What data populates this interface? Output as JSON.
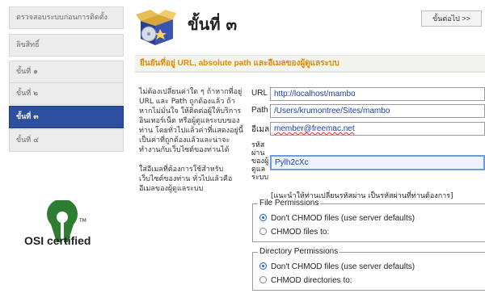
{
  "sidebar": {
    "items": [
      {
        "label": "ตรวจสอบระบบก่อนการติดตั้ง",
        "active": false
      },
      {
        "label": "ลิขสิทธิ์",
        "active": false
      },
      {
        "label": "ขั้นที่ ๑",
        "active": false
      },
      {
        "label": "ขั้นที่ ๒",
        "active": false
      },
      {
        "label": "ขั้นที่ ๓",
        "active": true
      },
      {
        "label": "ขั้นที่ ๔",
        "active": false
      }
    ],
    "logo_text": "OSI certified",
    "logo_tm": "TM"
  },
  "header": {
    "title": "ขั้นที่ ๓",
    "next_label": "ขั้นต่อไป >>",
    "icon": "install-box-icon"
  },
  "subheader": "ยืนยันที่อยู่ URL, absolute path และอีเมลของผู้ดูแลระบบ",
  "description": {
    "p1": "ไม่ต้องเปลี่ยนค่าใด ๆ ถ้าหากที่อยู่ URL และ Path ถูกต้องแล้ว ถ้าหากไม่มั่นใจ ให้ติดต่อผู้ให้บริการอินเทอร์เน็ต หรือผู้ดูแลระบบของท่าน โดยทั่วไปแล้วค่าที่แสดงอยู่นี้เป็นค่าที่ถูกต้องแล้วและน่าจะทำงานกับเว็บไซต์ของท่านได้",
    "p2": "ใส่อีเมลที่ต้องการใช้สำหรับเว็บไซต์ของท่าน ทั่วไปแล้วคืออีเมลของผู้ดูแลระบบ"
  },
  "form": {
    "url_label": "URL",
    "url_value": "http://localhost/mambo",
    "path_label": "Path",
    "path_value": "/Users/krumontree/Sites/mambo",
    "email_label": "อีเมล",
    "email_value": "member@freemac.net",
    "pw_label": "รหัสผ่านของผู้ดูแลระบบ",
    "pw_value": "Pylh2cXc",
    "pw_hint": "[แนะนำให้ท่านเปลี่ยนรหัสผ่าน เป็นรหัสผ่านที่ท่านต้องการ]"
  },
  "file_permissions": {
    "legend": "File Permissions",
    "opt1": "Don't CHMOD files (use server defaults)",
    "opt2": "CHMOD files to:"
  },
  "dir_permissions": {
    "legend": "Directory Permissions",
    "opt1": "Don't CHMOD files (use server defaults)",
    "opt2": "CHMOD directories to:"
  },
  "colors": {
    "accent_orange": "#e08a00",
    "active_step": "#2d4fa0",
    "input_text": "#1a3fa8"
  }
}
